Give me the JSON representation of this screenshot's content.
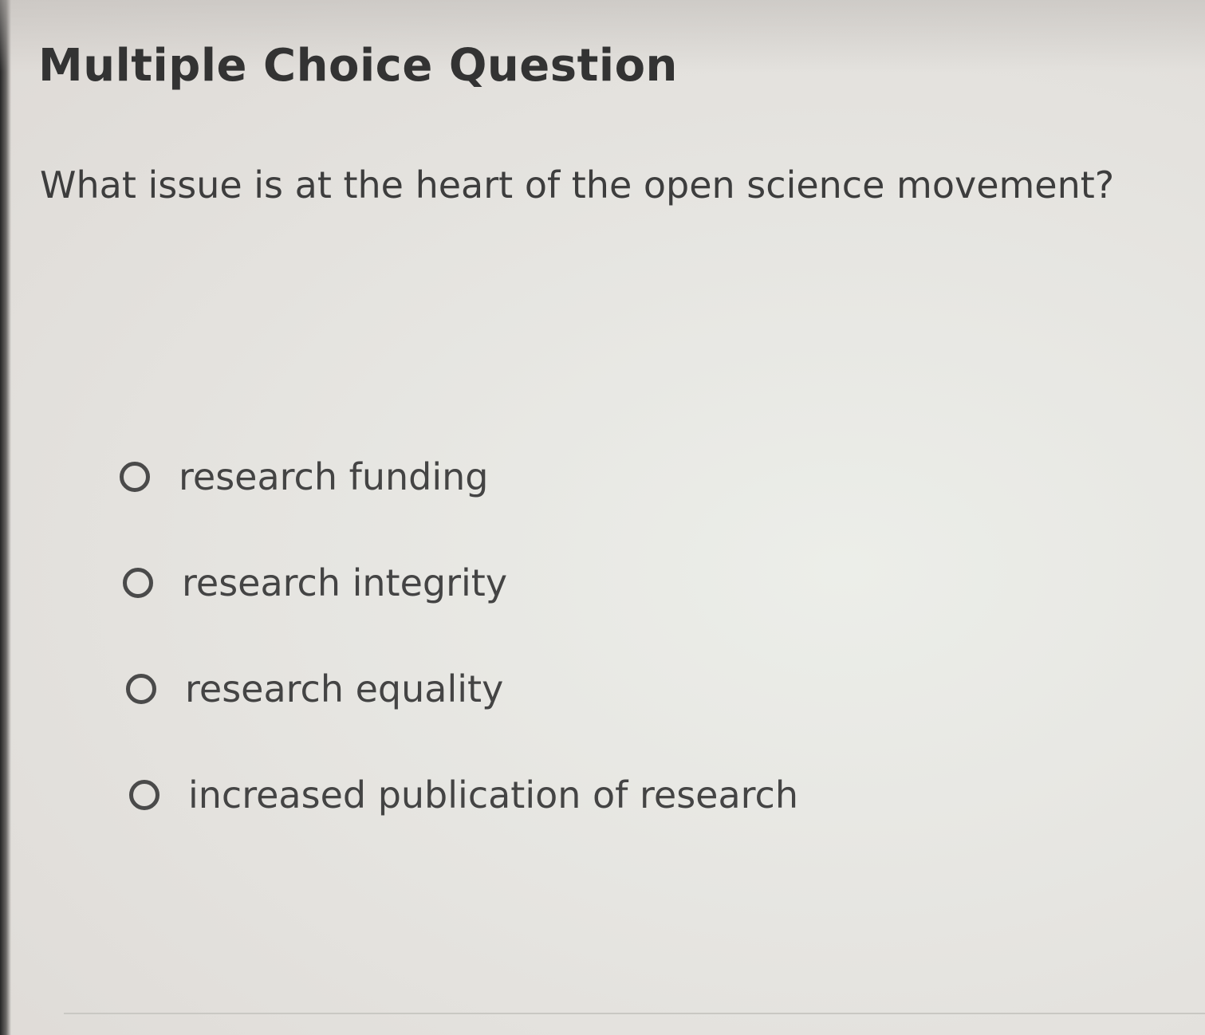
{
  "question": {
    "type_label": "Multiple Choice Question",
    "prompt": "What issue is at the heart of the open science movement?",
    "options": [
      {
        "label": "research funding",
        "selected": false
      },
      {
        "label": "research integrity",
        "selected": false
      },
      {
        "label": "research equality",
        "selected": false
      },
      {
        "label": "increased publication of research",
        "selected": false
      }
    ]
  },
  "icons": {
    "radio": "radio-button-empty-icon"
  }
}
